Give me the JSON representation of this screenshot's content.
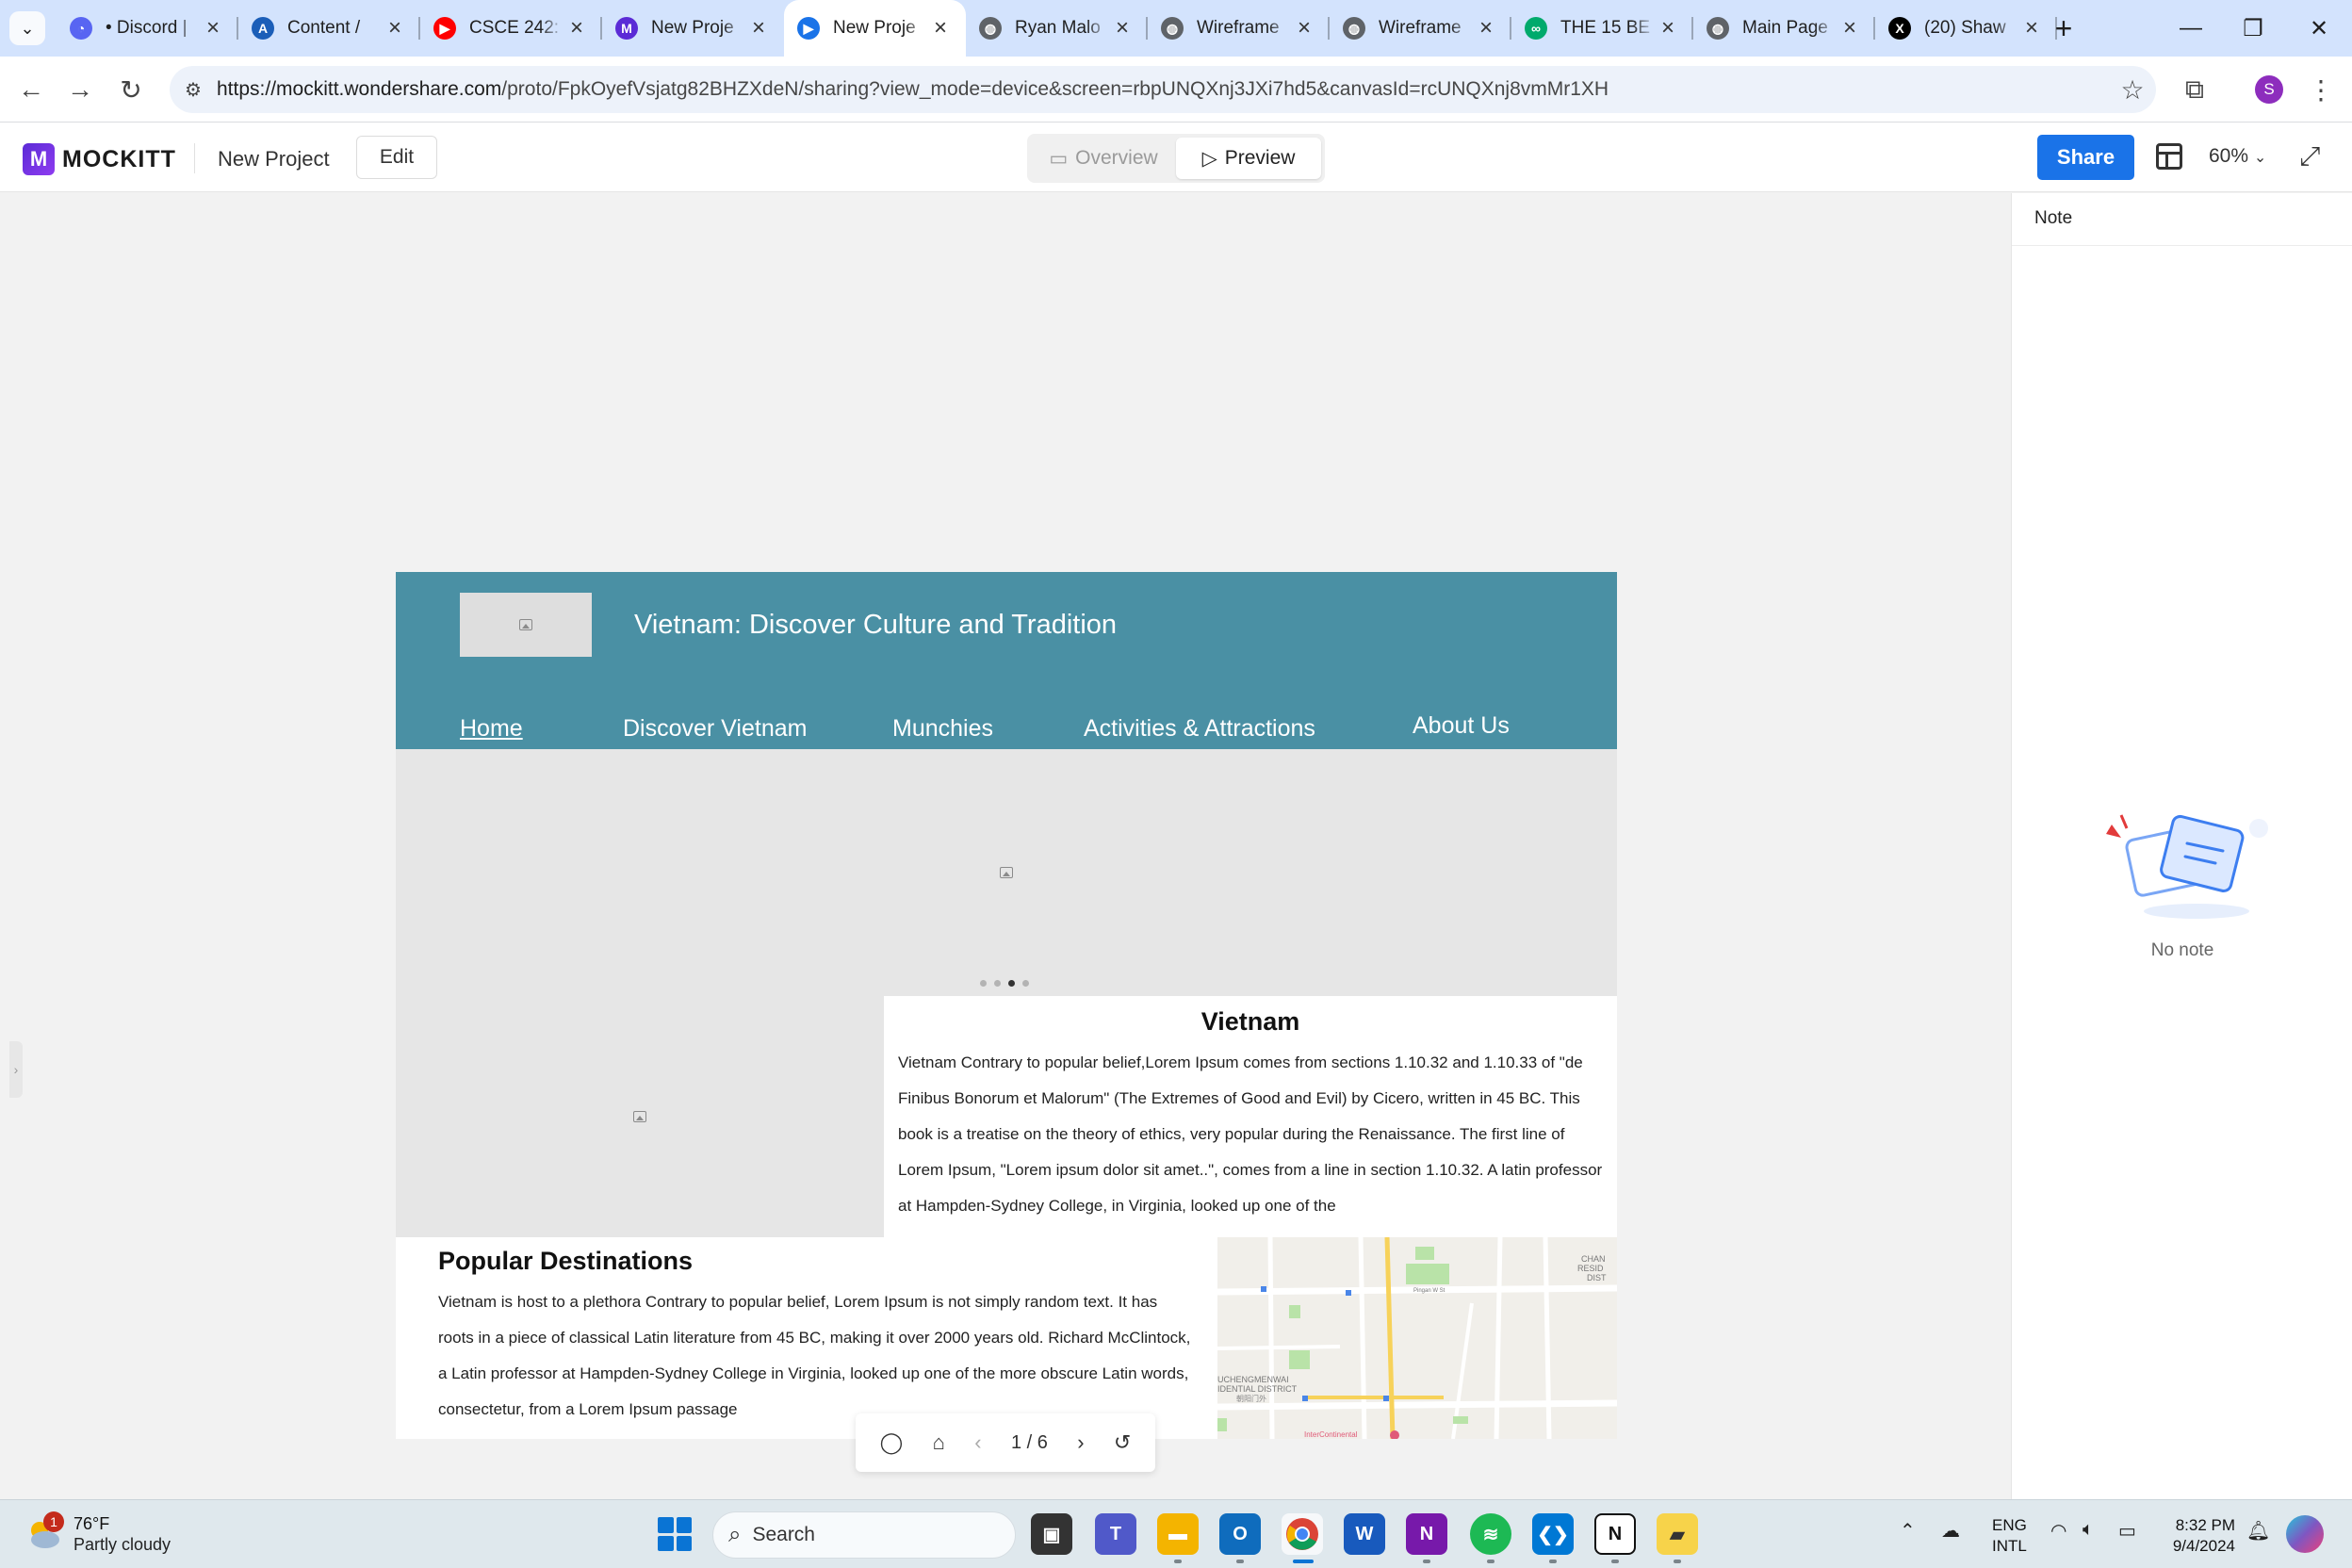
{
  "browser": {
    "tabs": [
      {
        "title": "• Discord |",
        "fav_color": "#5865f2",
        "fav_glyph": "◔"
      },
      {
        "title": "Content /",
        "fav_color": "#1b5eb8",
        "fav_glyph": "A"
      },
      {
        "title": "CSCE 242:",
        "fav_color": "#ff0000",
        "fav_glyph": "▶"
      },
      {
        "title": "New Proje",
        "fav_color": "#5b2bd6",
        "fav_glyph": "M"
      },
      {
        "title": "New Proje",
        "fav_color": "#1a73e8",
        "fav_glyph": "▶"
      },
      {
        "title": "Ryan Malo",
        "fav_color": "#5f6368",
        "fav_glyph": "◍"
      },
      {
        "title": "Wireframe",
        "fav_color": "#5f6368",
        "fav_glyph": "◍"
      },
      {
        "title": "Wireframe",
        "fav_color": "#5f6368",
        "fav_glyph": "◍"
      },
      {
        "title": "THE 15 BE",
        "fav_color": "#00aa6c",
        "fav_glyph": "∞"
      },
      {
        "title": "Main Page",
        "fav_color": "#5f6368",
        "fav_glyph": "◍"
      },
      {
        "title": "(20) Shaw",
        "fav_color": "#000000",
        "fav_glyph": "X"
      }
    ],
    "active_tab_index": 4,
    "url_host": "https://mockitt.wondershare.com",
    "url_path": "/proto/FpkOyefVsjatg82BHZXdeN/sharing?view_mode=device&screen=rbpUNQXnj3JXi7hd5&canvasId=rcUNQXnj8vmMr1XH",
    "profile_initial": "S"
  },
  "mockitt": {
    "logo_text": "MOCKITT",
    "logo_mark": "M",
    "project_name": "New Project",
    "edit_label": "Edit",
    "overview_label": "Overview",
    "preview_label": "Preview",
    "share_label": "Share",
    "zoom": "60%",
    "note_title": "Note",
    "no_note": "No note",
    "pager": "1 / 6"
  },
  "prototype": {
    "site_title": "Vietnam: Discover Culture and Tradition",
    "nav": [
      "Home",
      "Discover Vietnam",
      "Munchies",
      "Activities & Attractions",
      "About Us"
    ],
    "current_nav": "Home",
    "carousel_dots": 4,
    "carousel_active": 2,
    "about_title": "Vietnam",
    "about_text": "Vietnam Contrary to popular belief,Lorem Ipsum comes from sections 1.10.32 and 1.10.33 of \"de Finibus Bonorum et Malorum\" (The Extremes of Good and Evil) by Cicero, written in 45 BC. This book is a treatise on the theory of ethics, very popular during the Renaissance. The first line of Lorem Ipsum, \"Lorem ipsum dolor sit amet..\", comes from a line in section 1.10.32. A latin professor at Hampden-Sydney College, in Virginia, looked up one of the",
    "dest_title": "Popular Destinations",
    "dest_text": "Vietnam is host to a plethora Contrary to popular belief, Lorem Ipsum is not simply random text. It has roots in a piece of classical Latin literature from 45 BC, making it over 2000 years old. Richard McClintock, a Latin professor at Hampden-Sydney College in Virginia, looked up one of the more obscure Latin words, consectetur, from a Lorem Ipsum passage",
    "map_labels": {
      "district": "UCHENGMENWAI\nIDENTIAL DISTRICT",
      "district_cn": "朝阳门外",
      "right": "CHAN\nRESID\nDIST",
      "road": "Pingan W St",
      "poi": "InterContinental"
    }
  },
  "taskbar": {
    "temp": "76°F",
    "condition": "Partly cloudy",
    "badge": "1",
    "search_placeholder": "Search",
    "lang1": "ENG",
    "lang2": "INTL",
    "time": "8:32 PM",
    "date": "9/4/2024"
  }
}
